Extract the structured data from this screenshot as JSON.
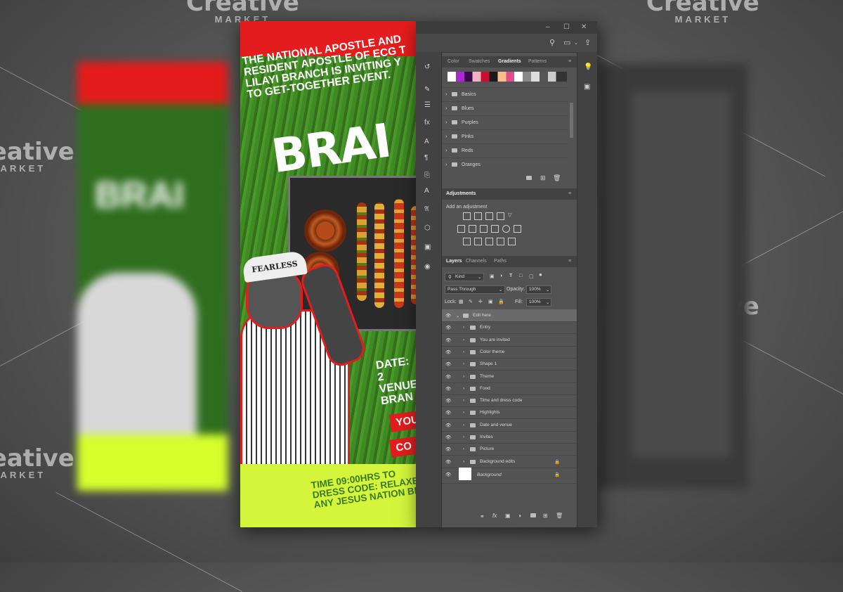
{
  "watermark": {
    "brand": "Creative",
    "sub": "MARKET"
  },
  "flyer": {
    "intro_lines": [
      "THE NATIONAL APOSTLE AND",
      "RESIDENT APOSTLE OF ECG T",
      "LILAYI BRANCH IS INVITING Y",
      "TO GET-TOGETHER EVENT."
    ],
    "headline": "BRAI",
    "cap_text": "FEARLESS",
    "date_lines": [
      "DATE: 2",
      "VENUE",
      "BRAN"
    ],
    "button1": "YOU",
    "button2": "CO",
    "bottom_lines": [
      "TIME 09:00HRS TO",
      "DRESS CODE: RELAXE",
      "ANY JESUS NATION BR"
    ],
    "bg_headline": "BRAI",
    "colors": {
      "red": "#e31d1d",
      "green": "#3a7a22",
      "yellow": "#d4f53c"
    }
  },
  "photoshop": {
    "window_controls": [
      "–",
      "☐",
      "✕"
    ],
    "top_icons": [
      "search-icon",
      "workspace-icon",
      "share-icon"
    ],
    "swatch_tabs": [
      {
        "label": "Color",
        "active": false
      },
      {
        "label": "Swatches",
        "active": false
      },
      {
        "label": "Gradients",
        "active": true
      },
      {
        "label": "Patterns",
        "active": false
      }
    ],
    "gradient_groups": [
      "Basics",
      "Blues",
      "Purples",
      "Pinks",
      "Reds",
      "Oranges"
    ],
    "adjustments": {
      "title": "Adjustments",
      "hint": "Add an adjustment"
    },
    "layer_tabs": [
      {
        "label": "Layers",
        "active": true
      },
      {
        "label": "Channels",
        "active": false
      },
      {
        "label": "Paths",
        "active": false
      }
    ],
    "kind_label": "Kind",
    "blend_mode": "Pass Through",
    "opacity_label": "Opacity:",
    "opacity_value": "100%",
    "lock_label": "Lock:",
    "fill_label": "Fill:",
    "fill_value": "100%",
    "layers": [
      {
        "name": "Edit here",
        "selected": true,
        "open": true,
        "locked": false
      },
      {
        "name": "Entry",
        "selected": false,
        "locked": false
      },
      {
        "name": "You are invited",
        "selected": false,
        "locked": false
      },
      {
        "name": "Color theme",
        "selected": false,
        "locked": false
      },
      {
        "name": "Shape 1",
        "selected": false,
        "locked": false
      },
      {
        "name": "Theme",
        "selected": false,
        "locked": false
      },
      {
        "name": "Food",
        "selected": false,
        "locked": false
      },
      {
        "name": "Time and dress code",
        "selected": false,
        "locked": false
      },
      {
        "name": "Highlights",
        "selected": false,
        "locked": false
      },
      {
        "name": "Date and venue",
        "selected": false,
        "locked": false
      },
      {
        "name": "Invites",
        "selected": false,
        "locked": false
      },
      {
        "name": "Picture",
        "selected": false,
        "locked": false
      },
      {
        "name": "Background edits",
        "selected": false,
        "locked": true
      }
    ],
    "background_layer": "Background"
  }
}
